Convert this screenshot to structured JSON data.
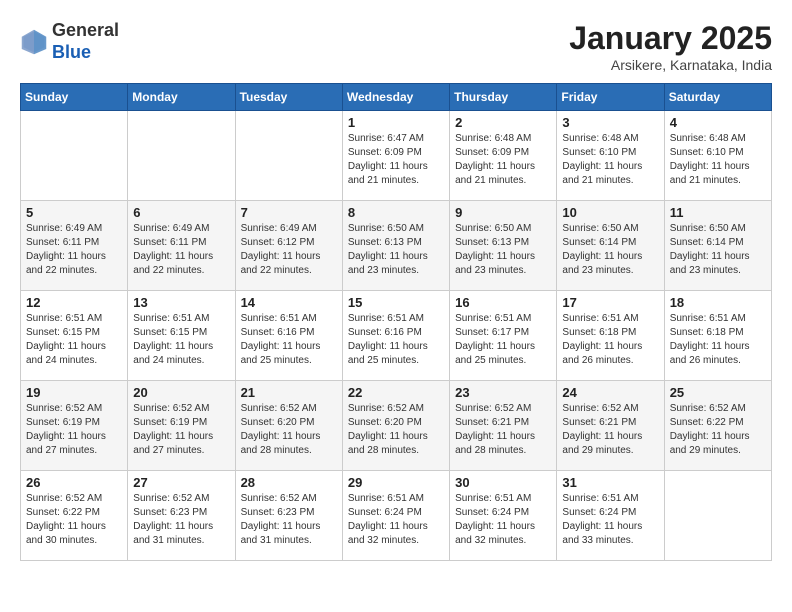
{
  "header": {
    "logo_general": "General",
    "logo_blue": "Blue",
    "month": "January 2025",
    "location": "Arsikere, Karnataka, India"
  },
  "weekdays": [
    "Sunday",
    "Monday",
    "Tuesday",
    "Wednesday",
    "Thursday",
    "Friday",
    "Saturday"
  ],
  "weeks": [
    [
      {
        "day": "",
        "info": ""
      },
      {
        "day": "",
        "info": ""
      },
      {
        "day": "",
        "info": ""
      },
      {
        "day": "1",
        "info": "Sunrise: 6:47 AM\nSunset: 6:09 PM\nDaylight: 11 hours\nand 21 minutes."
      },
      {
        "day": "2",
        "info": "Sunrise: 6:48 AM\nSunset: 6:09 PM\nDaylight: 11 hours\nand 21 minutes."
      },
      {
        "day": "3",
        "info": "Sunrise: 6:48 AM\nSunset: 6:10 PM\nDaylight: 11 hours\nand 21 minutes."
      },
      {
        "day": "4",
        "info": "Sunrise: 6:48 AM\nSunset: 6:10 PM\nDaylight: 11 hours\nand 21 minutes."
      }
    ],
    [
      {
        "day": "5",
        "info": "Sunrise: 6:49 AM\nSunset: 6:11 PM\nDaylight: 11 hours\nand 22 minutes."
      },
      {
        "day": "6",
        "info": "Sunrise: 6:49 AM\nSunset: 6:11 PM\nDaylight: 11 hours\nand 22 minutes."
      },
      {
        "day": "7",
        "info": "Sunrise: 6:49 AM\nSunset: 6:12 PM\nDaylight: 11 hours\nand 22 minutes."
      },
      {
        "day": "8",
        "info": "Sunrise: 6:50 AM\nSunset: 6:13 PM\nDaylight: 11 hours\nand 23 minutes."
      },
      {
        "day": "9",
        "info": "Sunrise: 6:50 AM\nSunset: 6:13 PM\nDaylight: 11 hours\nand 23 minutes."
      },
      {
        "day": "10",
        "info": "Sunrise: 6:50 AM\nSunset: 6:14 PM\nDaylight: 11 hours\nand 23 minutes."
      },
      {
        "day": "11",
        "info": "Sunrise: 6:50 AM\nSunset: 6:14 PM\nDaylight: 11 hours\nand 23 minutes."
      }
    ],
    [
      {
        "day": "12",
        "info": "Sunrise: 6:51 AM\nSunset: 6:15 PM\nDaylight: 11 hours\nand 24 minutes."
      },
      {
        "day": "13",
        "info": "Sunrise: 6:51 AM\nSunset: 6:15 PM\nDaylight: 11 hours\nand 24 minutes."
      },
      {
        "day": "14",
        "info": "Sunrise: 6:51 AM\nSunset: 6:16 PM\nDaylight: 11 hours\nand 25 minutes."
      },
      {
        "day": "15",
        "info": "Sunrise: 6:51 AM\nSunset: 6:16 PM\nDaylight: 11 hours\nand 25 minutes."
      },
      {
        "day": "16",
        "info": "Sunrise: 6:51 AM\nSunset: 6:17 PM\nDaylight: 11 hours\nand 25 minutes."
      },
      {
        "day": "17",
        "info": "Sunrise: 6:51 AM\nSunset: 6:18 PM\nDaylight: 11 hours\nand 26 minutes."
      },
      {
        "day": "18",
        "info": "Sunrise: 6:51 AM\nSunset: 6:18 PM\nDaylight: 11 hours\nand 26 minutes."
      }
    ],
    [
      {
        "day": "19",
        "info": "Sunrise: 6:52 AM\nSunset: 6:19 PM\nDaylight: 11 hours\nand 27 minutes."
      },
      {
        "day": "20",
        "info": "Sunrise: 6:52 AM\nSunset: 6:19 PM\nDaylight: 11 hours\nand 27 minutes."
      },
      {
        "day": "21",
        "info": "Sunrise: 6:52 AM\nSunset: 6:20 PM\nDaylight: 11 hours\nand 28 minutes."
      },
      {
        "day": "22",
        "info": "Sunrise: 6:52 AM\nSunset: 6:20 PM\nDaylight: 11 hours\nand 28 minutes."
      },
      {
        "day": "23",
        "info": "Sunrise: 6:52 AM\nSunset: 6:21 PM\nDaylight: 11 hours\nand 28 minutes."
      },
      {
        "day": "24",
        "info": "Sunrise: 6:52 AM\nSunset: 6:21 PM\nDaylight: 11 hours\nand 29 minutes."
      },
      {
        "day": "25",
        "info": "Sunrise: 6:52 AM\nSunset: 6:22 PM\nDaylight: 11 hours\nand 29 minutes."
      }
    ],
    [
      {
        "day": "26",
        "info": "Sunrise: 6:52 AM\nSunset: 6:22 PM\nDaylight: 11 hours\nand 30 minutes."
      },
      {
        "day": "27",
        "info": "Sunrise: 6:52 AM\nSunset: 6:23 PM\nDaylight: 11 hours\nand 31 minutes."
      },
      {
        "day": "28",
        "info": "Sunrise: 6:52 AM\nSunset: 6:23 PM\nDaylight: 11 hours\nand 31 minutes."
      },
      {
        "day": "29",
        "info": "Sunrise: 6:51 AM\nSunset: 6:24 PM\nDaylight: 11 hours\nand 32 minutes."
      },
      {
        "day": "30",
        "info": "Sunrise: 6:51 AM\nSunset: 6:24 PM\nDaylight: 11 hours\nand 32 minutes."
      },
      {
        "day": "31",
        "info": "Sunrise: 6:51 AM\nSunset: 6:24 PM\nDaylight: 11 hours\nand 33 minutes."
      },
      {
        "day": "",
        "info": ""
      }
    ]
  ]
}
